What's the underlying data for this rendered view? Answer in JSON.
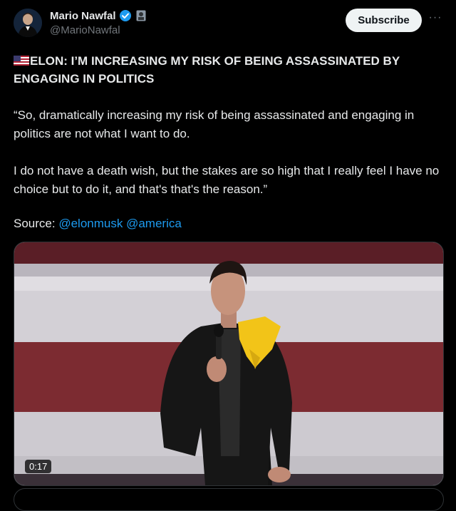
{
  "author": {
    "display_name": "Mario Nawfal",
    "handle": "@MarioNawfal"
  },
  "actions": {
    "subscribe_label": "Subscribe",
    "more_label": "···"
  },
  "post": {
    "headline": "ELON: I’M INCREASING MY RISK OF BEING ASSASSINATED BY ENGAGING IN POLITICS",
    "paragraph_1": "“So, dramatically increasing my risk of being assassinated and engaging in politics are not what I want to do.",
    "paragraph_2": "I do not have a death wish, but the stakes are so high that I really feel I have no choice but to do it, and that's that's the reason.”",
    "source_label": "Source:",
    "mentions": [
      "@elonmusk",
      "@america"
    ]
  },
  "media": {
    "duration": "0:17"
  },
  "colors": {
    "accent": "#1d9bf0",
    "background": "#000000",
    "text": "#e7e9ea",
    "muted": "#71767b",
    "subscribe_bg": "#eff3f4"
  },
  "icons": [
    "verified-badge-icon",
    "affiliate-badge-icon",
    "us-flag-icon",
    "more-icon"
  ]
}
